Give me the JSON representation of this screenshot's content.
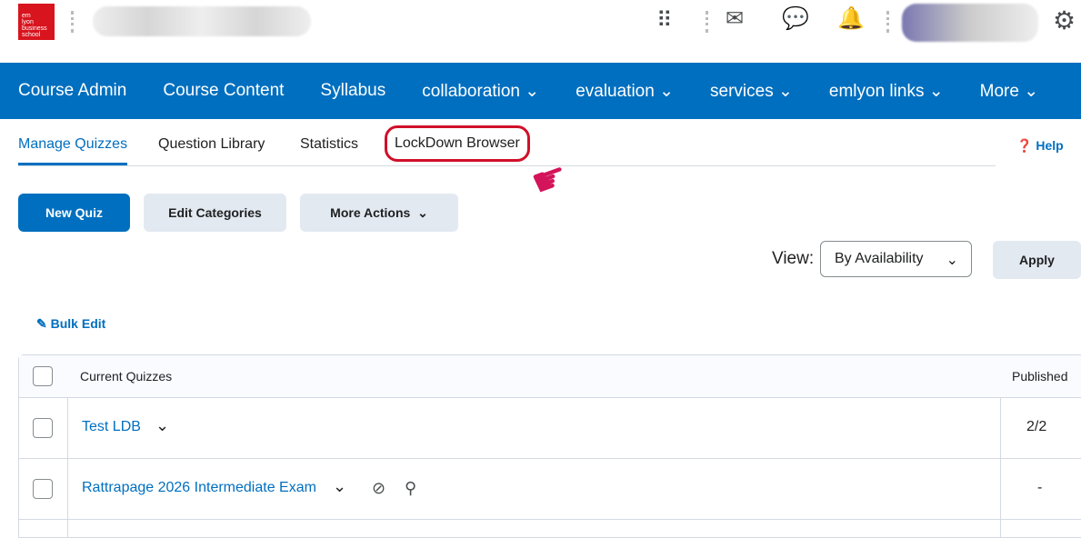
{
  "logo": "em lyon business school",
  "nav": [
    "Course Admin",
    "Course Content",
    "Syllabus",
    "collaboration ⌄",
    "evaluation ⌄",
    "services ⌄",
    "emlyon links ⌄",
    "More ⌄"
  ],
  "tabs": {
    "manage": "Manage Quizzes",
    "library": "Question Library",
    "stats": "Statistics",
    "ldb": "LockDown Browser"
  },
  "help": "Help",
  "buttons": {
    "new": "New Quiz",
    "edit": "Edit Categories",
    "more": "More Actions"
  },
  "view": {
    "label": "View:",
    "value": "By Availability",
    "apply": "Apply"
  },
  "bulk": "Bulk Edit",
  "table": {
    "col1": "Current Quizzes",
    "col2": "Published",
    "rows": [
      {
        "name": "Test LDB",
        "published": "2/2"
      },
      {
        "name": "Rattrapage 2026 Intermediate Exam",
        "published": "-"
      }
    ]
  }
}
